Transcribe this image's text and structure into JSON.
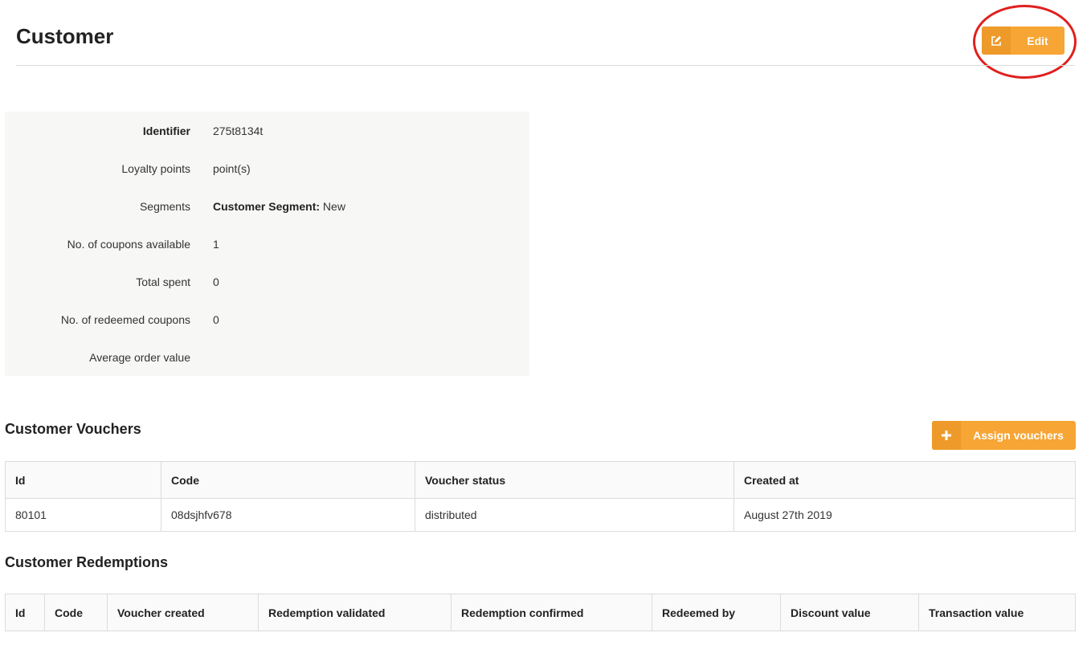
{
  "header": {
    "title": "Customer",
    "edit_button": {
      "label": "Edit",
      "icon": "edit-icon"
    }
  },
  "customer_info": {
    "rows": [
      {
        "label": "Identifier",
        "value": "275t8134t"
      },
      {
        "label": "Loyalty points",
        "value": "point(s)"
      },
      {
        "label": "Segments",
        "value_key": "Customer Segment:",
        "value": "New"
      },
      {
        "label": "No. of coupons available",
        "value": "1"
      },
      {
        "label": "Total spent",
        "value": "0"
      },
      {
        "label": "No. of redeemed coupons",
        "value": "0"
      },
      {
        "label": "Average order value",
        "value": ""
      }
    ]
  },
  "vouchers": {
    "title": "Customer Vouchers",
    "assign_button": {
      "label": "Assign vouchers",
      "icon": "plus-icon"
    },
    "columns": [
      "Id",
      "Code",
      "Voucher status",
      "Created at"
    ],
    "rows": [
      [
        "80101",
        "08dsjhfv678",
        "distributed",
        "August 27th 2019"
      ]
    ]
  },
  "redemptions": {
    "title": "Customer Redemptions",
    "columns": [
      "Id",
      "Code",
      "Voucher created",
      "Redemption validated",
      "Redemption confirmed",
      "Redeemed by",
      "Discount value",
      "Transaction value"
    ],
    "rows": []
  },
  "colors": {
    "accent": "#f7a534",
    "accent_dark": "#ed9a2a",
    "highlight_ring": "#e0201f",
    "panel_bg": "#f7f7f5"
  }
}
